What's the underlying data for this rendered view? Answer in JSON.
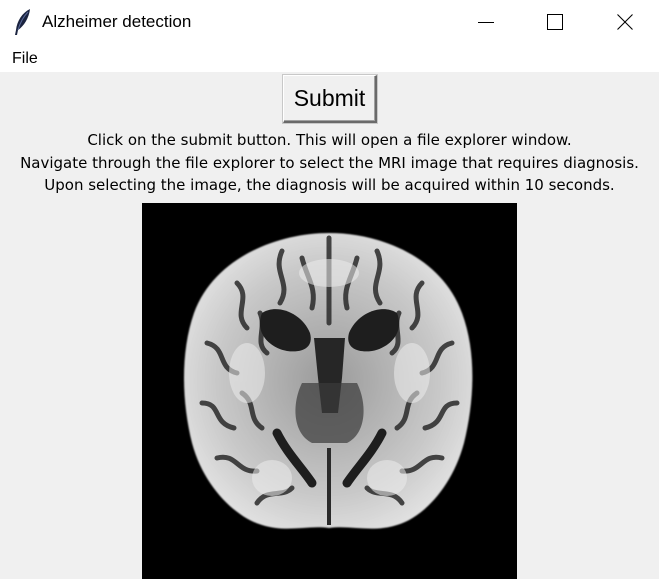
{
  "window": {
    "title": "Alzheimer detection",
    "app_icon": "feather-icon",
    "controls": {
      "minimize_icon": "minimize-icon",
      "maximize_icon": "maximize-icon",
      "close_icon": "close-icon"
    }
  },
  "menubar": {
    "items": [
      {
        "label": "File"
      }
    ]
  },
  "main": {
    "submit_label": "Submit",
    "instructions": [
      "Click on the submit button. This will open a file explorer window.",
      "Navigate through the file explorer to select the MRI image that requires diagnosis.",
      "Upon selecting the image, the diagnosis will be acquired within 10 seconds."
    ],
    "image": {
      "description_icon": "brain-mri-image",
      "background_color": "#000000"
    }
  }
}
